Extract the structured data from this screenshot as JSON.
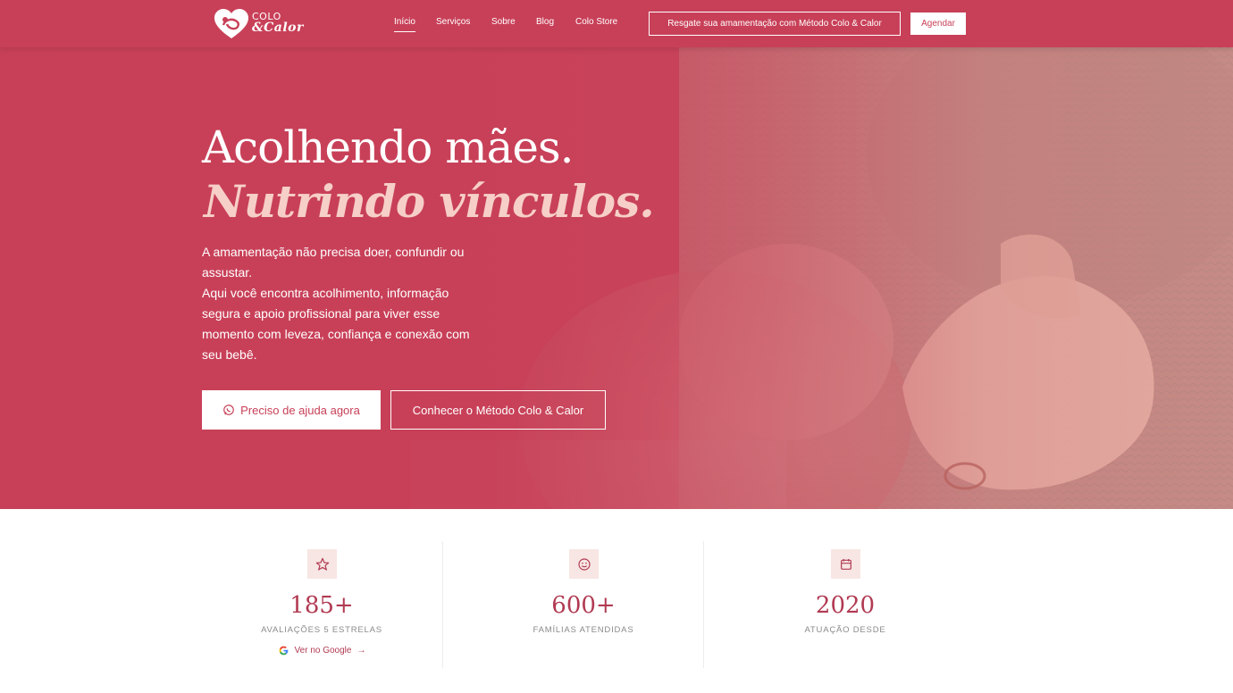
{
  "brand": {
    "line1": "COLO",
    "line2": "&Calor",
    "color": "#c84058"
  },
  "nav": {
    "items": [
      {
        "label": "Início",
        "active": true
      },
      {
        "label": "Serviços",
        "active": false
      },
      {
        "label": "Sobre",
        "active": false
      },
      {
        "label": "Blog",
        "active": false
      },
      {
        "label": "Colo Store",
        "active": false
      }
    ],
    "resgate_label": "Resgate sua amamentação com Método Colo & Calor",
    "agendar_label": "Agendar"
  },
  "hero": {
    "title": "Acolhendo mães.",
    "subtitle": "Nutrindo vínculos.",
    "paragraph1": "A amamentação não precisa doer, confundir ou assustar.",
    "paragraph2": "Aqui você encontra acolhimento, informação segura e apoio profissional para viver esse momento com leveza, confiança e conexão com seu bebê.",
    "cta_primary": "Preciso de ajuda agora",
    "cta_primary_icon": "whatsapp-icon",
    "cta_secondary": "Conhecer o Método Colo & Calor"
  },
  "stats": [
    {
      "icon": "star-icon",
      "value": "185+",
      "label": "AVALIAÇÕES 5 ESTRELAS",
      "link": "Ver no Google",
      "link_icon": "google-icon",
      "arrow": "→"
    },
    {
      "icon": "smile-icon",
      "value": "600+",
      "label": "FAMÍLIAS ATENDIDAS"
    },
    {
      "icon": "calendar-icon",
      "value": "2020",
      "label": "ATUAÇÃO DESDE"
    }
  ],
  "colors": {
    "accent": "#c84058",
    "stat_value": "#b13a52",
    "icon_bg": "#f7e6e3",
    "subtitle": "#f6cfc8"
  }
}
